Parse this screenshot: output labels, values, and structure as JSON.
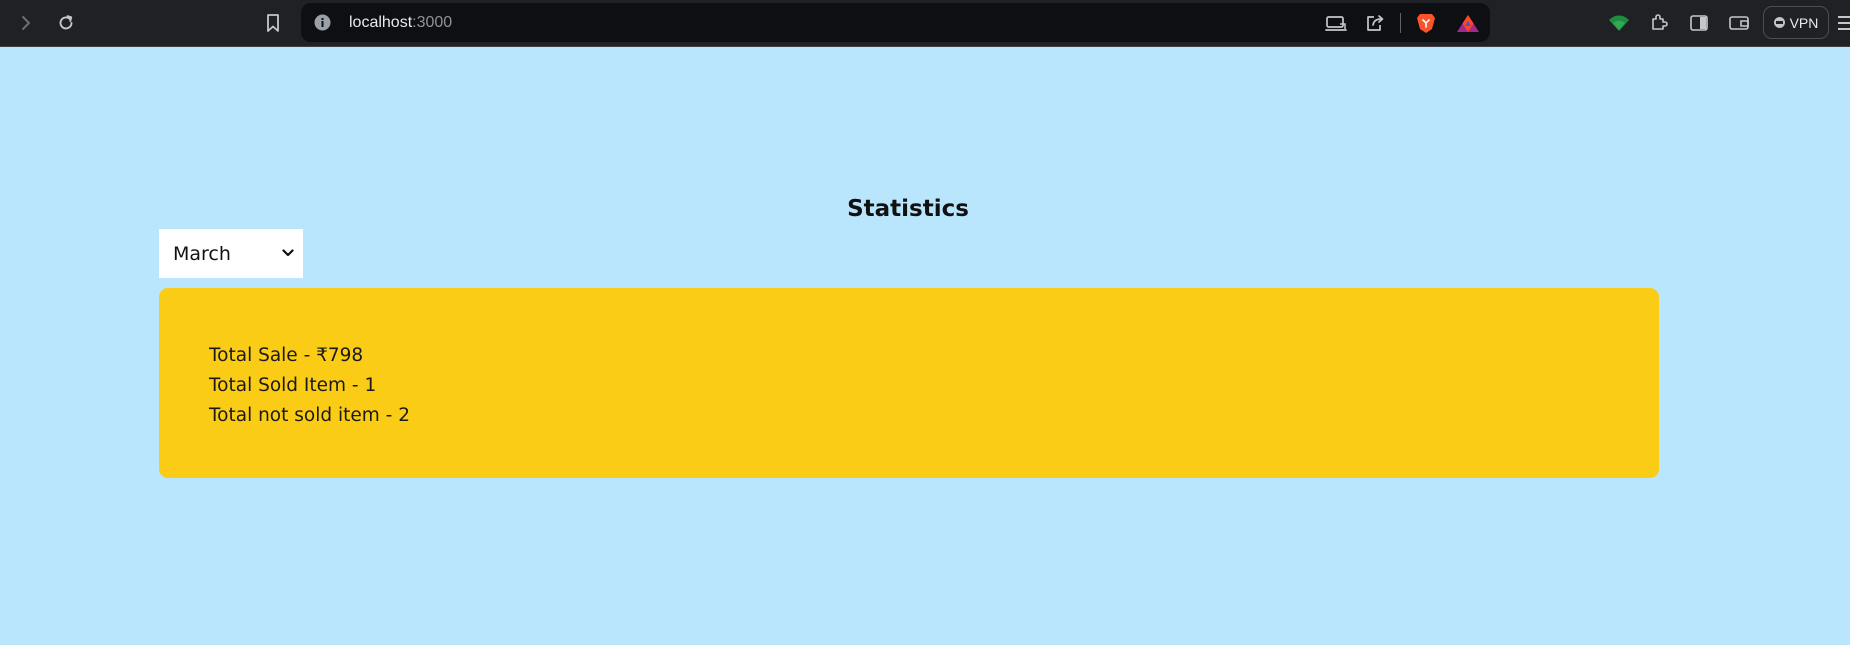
{
  "browser": {
    "url_host": "localhost",
    "url_port": ":3000",
    "vpn_label": "VPN",
    "icons": [
      "forward-icon",
      "reload-icon",
      "bookmark-icon",
      "info-icon",
      "cast-icon",
      "share-icon",
      "brave-shield-icon",
      "brave-rewards-icon",
      "wifi-icon",
      "extensions-icon",
      "sidebar-icon",
      "wallet-icon",
      "menu-icon"
    ]
  },
  "page": {
    "title": "Statistics",
    "month_select": {
      "selected": "March"
    },
    "stats": {
      "total_sale": "Total Sale - ₹798",
      "total_sold": "Total Sold Item - 1",
      "total_not_sold": "Total not sold item - 2"
    }
  },
  "colors": {
    "page_background": "#bae6fd",
    "card_background": "#facc15",
    "chrome_background": "#202124",
    "url_bar_background": "#0e0f13"
  }
}
